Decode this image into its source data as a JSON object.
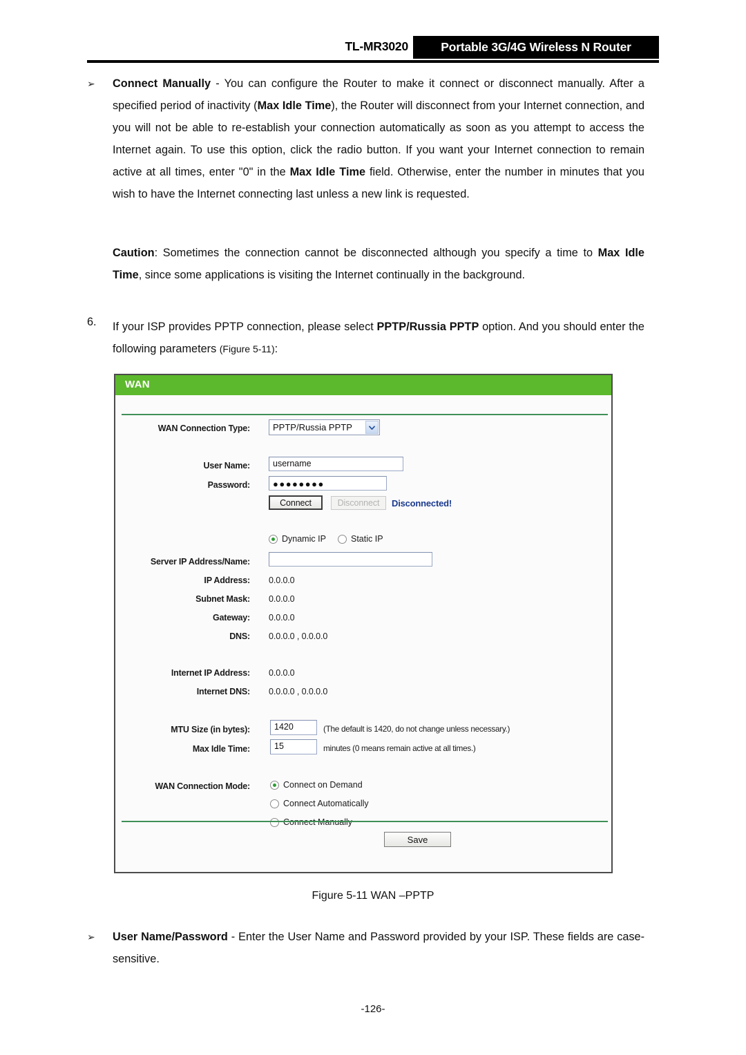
{
  "header": {
    "model": "TL-MR3020",
    "product": "Portable 3G/4G Wireless N Router"
  },
  "content": {
    "bullet_marker": "➢",
    "connect_manually": {
      "term": "Connect Manually",
      "dash": " - ",
      "text_1": "You can configure the Router to make it connect or disconnect manually. After a specified period of inactivity (",
      "emph_1": "Max Idle Time",
      "text_2": "), the Router will disconnect from your Internet connection, and you will not be able to re-establish your connection automatically as soon as you attempt to access the Internet again. To use this option, click the radio button. If you want your Internet connection to remain active at all times, enter \"0\" in the ",
      "emph_2": "Max Idle Time",
      "text_3": " field. Otherwise, enter the number in minutes that you wish to have the Internet connecting last unless a new link is requested."
    },
    "caution": {
      "term": "Caution",
      "text_1": ": Sometimes the connection cannot be disconnected although you specify a time to ",
      "emph_1": "Max Idle Time",
      "text_2": ", since some applications is visiting the Internet continually in the background."
    },
    "step6": {
      "number": "6.",
      "text_1": "If your ISP provides PPTP connection, please select ",
      "emph_1": "PPTP/Russia PPTP",
      "text_2": " option. And you should enter the following parameters ",
      "figure_ref": "(Figure 5-11)",
      "text_3": ":"
    },
    "user_name_password": {
      "term": "User Name/Password",
      "dash": " - ",
      "text": "Enter the User Name and Password provided by your ISP. These fields are case-sensitive."
    }
  },
  "wan_panel": {
    "title": "WAN",
    "header_color": "#5cb82c",
    "divider_color": "#3f8f56",
    "connection_type": {
      "label": "WAN Connection Type:",
      "value": "PPTP/Russia PPTP",
      "arrow_icon": "chevron-down-icon"
    },
    "user_name": {
      "label": "User Name:",
      "value": "username"
    },
    "password": {
      "label": "Password:",
      "value": "●●●●●●●●"
    },
    "connect_button": "Connect",
    "disconnect_button": "Disconnect",
    "status": "Disconnected!",
    "status_color": "#1b3a8f",
    "ip_mode": {
      "options": [
        "Dynamic IP",
        "Static IP"
      ],
      "selected": "Dynamic IP"
    },
    "server_ip": {
      "label": "Server IP Address/Name:",
      "value": ""
    },
    "ip_address": {
      "label": "IP Address:",
      "value": "0.0.0.0"
    },
    "subnet_mask": {
      "label": "Subnet Mask:",
      "value": "0.0.0.0"
    },
    "gateway": {
      "label": "Gateway:",
      "value": "0.0.0.0"
    },
    "dns": {
      "label": "DNS:",
      "value": "0.0.0.0 , 0.0.0.0"
    },
    "internet_ip": {
      "label": "Internet IP Address:",
      "value": "0.0.0.0"
    },
    "internet_dns": {
      "label": "Internet DNS:",
      "value": "0.0.0.0 , 0.0.0.0"
    },
    "mtu": {
      "label": "MTU Size (in bytes):",
      "value": "1420",
      "hint": "(The default is 1420, do not change unless necessary.)"
    },
    "max_idle": {
      "label": "Max Idle Time:",
      "value": "15",
      "hint": "minutes (0 means remain active at all times.)"
    },
    "connection_mode": {
      "label": "WAN Connection Mode:",
      "options": [
        "Connect on Demand",
        "Connect Automatically",
        "Connect Manually"
      ],
      "selected": "Connect on Demand"
    },
    "save_button": "Save"
  },
  "figure_caption": "Figure 5-11    WAN –PPTP",
  "page_number": "-126-"
}
